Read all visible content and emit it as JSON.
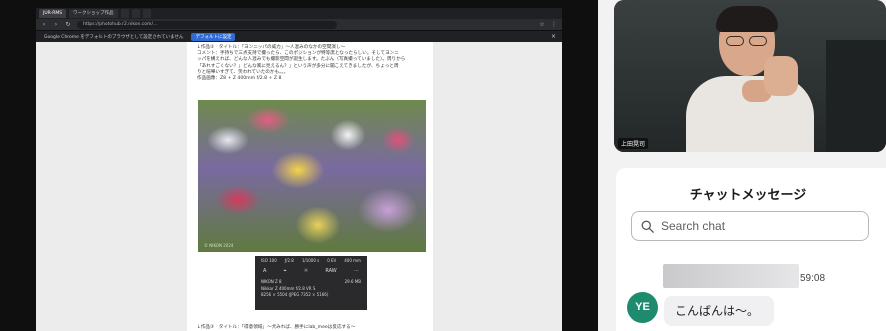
{
  "browser": {
    "tabs": [
      "JUR-RMS",
      "ワークショップ作品",
      "",
      "",
      ""
    ],
    "url": "https://photohub.r2.nikon.com/...",
    "bookmarks": [
      "受講者 作品 (Nikon...",
      "Nikon",
      "Gmail",
      "YouTube",
      "マップ",
      "アイコン",
      "新しいタブ...",
      "PHOTO Hub ホ..."
    ],
    "info_text": "Google Chrome をデフォルトのブラウザとして設定されていません",
    "info_button": "デフォルトに設定"
  },
  "document": {
    "para1_line1": "↓作品②　タイトル：「ヨンニッパの威力」〜人混みのなかの空間演し〜",
    "para1_line2": "コメント：手持ちで三点支持で撮ったら、このポジションが特等席となったらしい。そしてヨンニ",
    "para1_line3": "ッパを構えれば、どんな人混みでも撮影空間が誕生します。たぶん（写真撮っていました）。周りから",
    "para1_line4": "「あれすごくない？」どんな風に見えるん？」という声が多分に聞こえてきましたが、ちょっと周",
    "para1_line5": "りと喧嘩いすぎて、笑われていたのかも。。。",
    "para1_line6": "作品画像：Z8 + Z 400mm f/2.8 + Z 8",
    "photo_watermark": "© NIKON 2024",
    "bottom_line": "↓作品③　タイトル：「得意領域」〜犬みれば、勝手にlab_meeは反応する〜"
  },
  "exif": {
    "row1": [
      "ISO 100",
      "ƒ/2.8",
      "1/1000 s",
      "0 EV",
      "400 mm"
    ],
    "icons": [
      "A",
      "⌖",
      "☼",
      "RAW",
      "⋯"
    ],
    "camera": "NIKON Z 8",
    "size": "29.6 MB",
    "lens": "Nikkor Z 400mm f/2.8 VR S",
    "dims": "8256 × 5504 (JPEG 7352 × 5166)"
  },
  "video": {
    "participant_name": "上田晃司"
  },
  "chat": {
    "title": "チャットメッセージ",
    "search_placeholder": "Search chat",
    "time_fragment": "59:08",
    "avatar_initials": "YE",
    "message": "こんばんは〜。"
  },
  "colors": {
    "avatar": "#1e8a6e",
    "share_bg": "#0f0f10",
    "info_button": "#2f6bd6"
  }
}
